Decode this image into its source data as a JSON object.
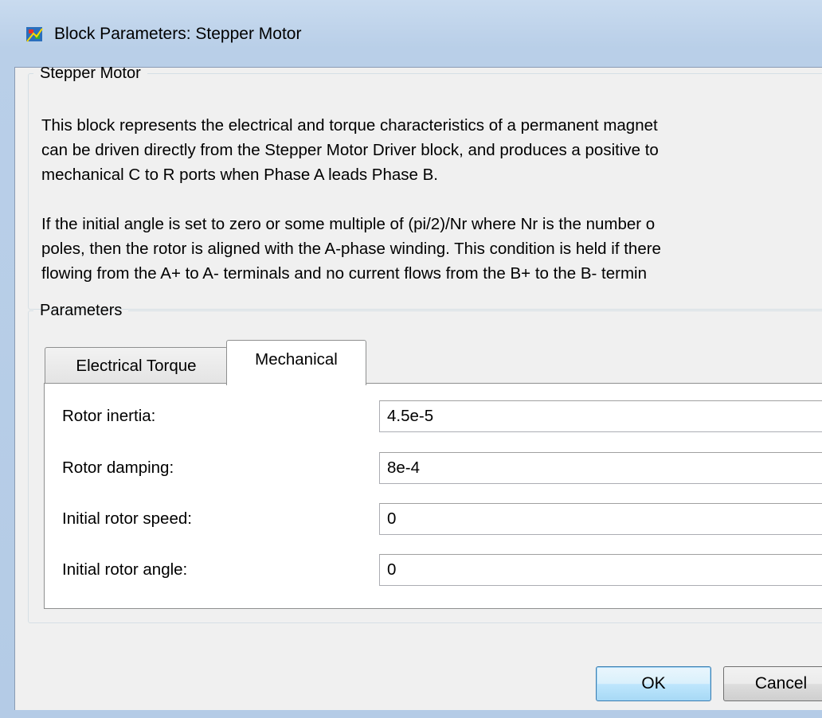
{
  "window": {
    "title": "Block Parameters: Stepper Motor"
  },
  "description_group": {
    "legend": "Stepper Motor",
    "paragraph1": [
      "This block represents the electrical and torque characteristics of a permanent magnet",
      "can be driven directly from the Stepper Motor Driver block, and produces a positive to",
      "mechanical C to R ports when Phase A leads Phase B."
    ],
    "paragraph2": [
      "If the initial angle is set to zero or some multiple of (pi/2)/Nr where Nr is the number o",
      "poles, then the rotor is aligned with the A-phase winding. This condition is held if there",
      "flowing from the A+ to A- terminals and no current flows from the B+ to the B- termin"
    ]
  },
  "parameters_group": {
    "legend": "Parameters",
    "tabs": [
      {
        "label": "Electrical Torque",
        "active": false
      },
      {
        "label": "Mechanical",
        "active": true
      }
    ],
    "fields": [
      {
        "label": "Rotor inertia:",
        "value": "4.5e-5"
      },
      {
        "label": "Rotor damping:",
        "value": "8e-4"
      },
      {
        "label": "Initial rotor speed:",
        "value": "0"
      },
      {
        "label": "Initial rotor angle:",
        "value": "0"
      }
    ]
  },
  "buttons": {
    "ok": "OK",
    "cancel": "Cancel"
  }
}
